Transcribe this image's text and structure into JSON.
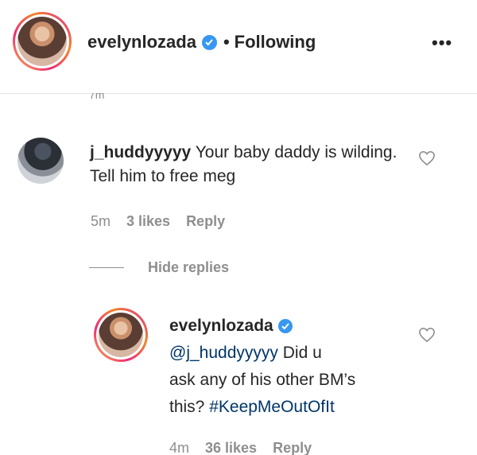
{
  "header": {
    "username": "evelynlozada",
    "separator": "•",
    "follow_status": "Following",
    "more_label": "•••",
    "partial_time": "7m"
  },
  "comment": {
    "username": "j_huddyyyyy",
    "text": "Your baby daddy is wilding. Tell him to free meg",
    "time": "5m",
    "likes": "3 likes",
    "reply_label": "Reply"
  },
  "replies_toggle": {
    "label": "Hide replies"
  },
  "reply": {
    "username": "evelynlozada",
    "mention": "@j_huddyyyyy",
    "text_line_1": "Did u",
    "text_line_2": "ask any of his other BM’s",
    "text_line_3": "this?",
    "hashtag": "#KeepMeOutOfIt",
    "time": "4m",
    "likes": "36 likes",
    "reply_label": "Reply"
  },
  "colors": {
    "verified_blue": "#3897f0",
    "meta_gray": "#8e8e8e",
    "link_blue": "#003569",
    "text": "#262626"
  }
}
